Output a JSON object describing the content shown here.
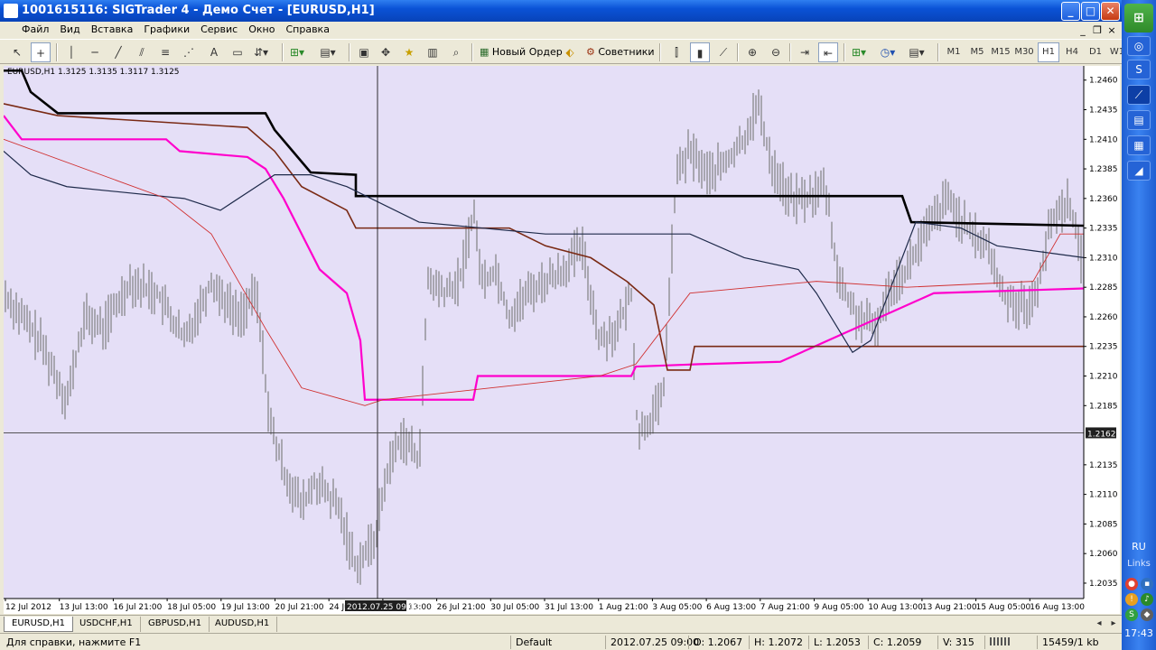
{
  "window": {
    "title": "1001615116: SIGTrader 4 - Демо Счет - [EURUSD,H1]",
    "minimize": "_",
    "maximize": "□",
    "close": "✕",
    "mdi_minimize": "_",
    "mdi_restore": "❐",
    "mdi_close": "×"
  },
  "menu": [
    "Файл",
    "Вид",
    "Вставка",
    "Графики",
    "Сервис",
    "Окно",
    "Справка"
  ],
  "toolbar": {
    "new_order": "Новый Ордер",
    "experts": "Советники",
    "text_tool": "A",
    "timeframes": [
      "M1",
      "M5",
      "M15",
      "M30",
      "H1",
      "H4",
      "D1",
      "W1"
    ],
    "active_timeframe": "H1"
  },
  "chart": {
    "header": "EURUSD,H1  1.3125 1.3135 1.3117 1.3125",
    "background": "#e5dff7",
    "y_labels": [
      "1.2460",
      "1.2435",
      "1.2410",
      "1.2385",
      "1.2360",
      "1.2335",
      "1.2310",
      "1.2285",
      "1.2260",
      "1.2235",
      "1.2210",
      "1.2185",
      "1.2162",
      "1.2135",
      "1.2110",
      "1.2085",
      "1.2060",
      "1.2035"
    ],
    "current_price": "1.2162",
    "x_labels": [
      "12 Jul 2012",
      "13 Jul 13:00",
      "16 Jul 21:00",
      "18 Jul 05:00",
      "19 Jul 13:00",
      "20 Jul 21:00",
      "24 Jul 05:00",
      "25 Jul 13:00",
      "26 Jul 21:00",
      "30 Jul 05:00",
      "31 Jul 13:00",
      "1 Aug 21:00",
      "3 Aug 05:00",
      "6 Aug 13:00",
      "7 Aug 21:00",
      "9 Aug 05:00",
      "10 Aug 13:00",
      "13 Aug 21:00",
      "15 Aug 05:00",
      "16 Aug 13:00"
    ],
    "crosshair_time": "2012.07.25 09:00",
    "colors": {
      "price": "#808080",
      "black_line": "#000000",
      "magenta_line": "#ff00cc",
      "brown_line": "#7a2a14",
      "navy_line": "#1e2a4a",
      "red_thin": "#d03030"
    }
  },
  "tabs": [
    "EURUSD,H1",
    "USDCHF,H1",
    "GBPUSD,H1",
    "AUDUSD,H1"
  ],
  "active_tab": "EURUSD,H1",
  "status": {
    "help": "Для справки, нажмите F1",
    "profile": "Default",
    "datetime": "2012.07.25 09:00",
    "open": "O: 1.2067",
    "high": "H: 1.2072",
    "low": "L: 1.2053",
    "close": "C: 1.2059",
    "volume": "V: 315",
    "traffic": "15459/1 kb"
  },
  "taskbar": {
    "lang": "RU",
    "links": "Links",
    "clock": "17:43"
  }
}
